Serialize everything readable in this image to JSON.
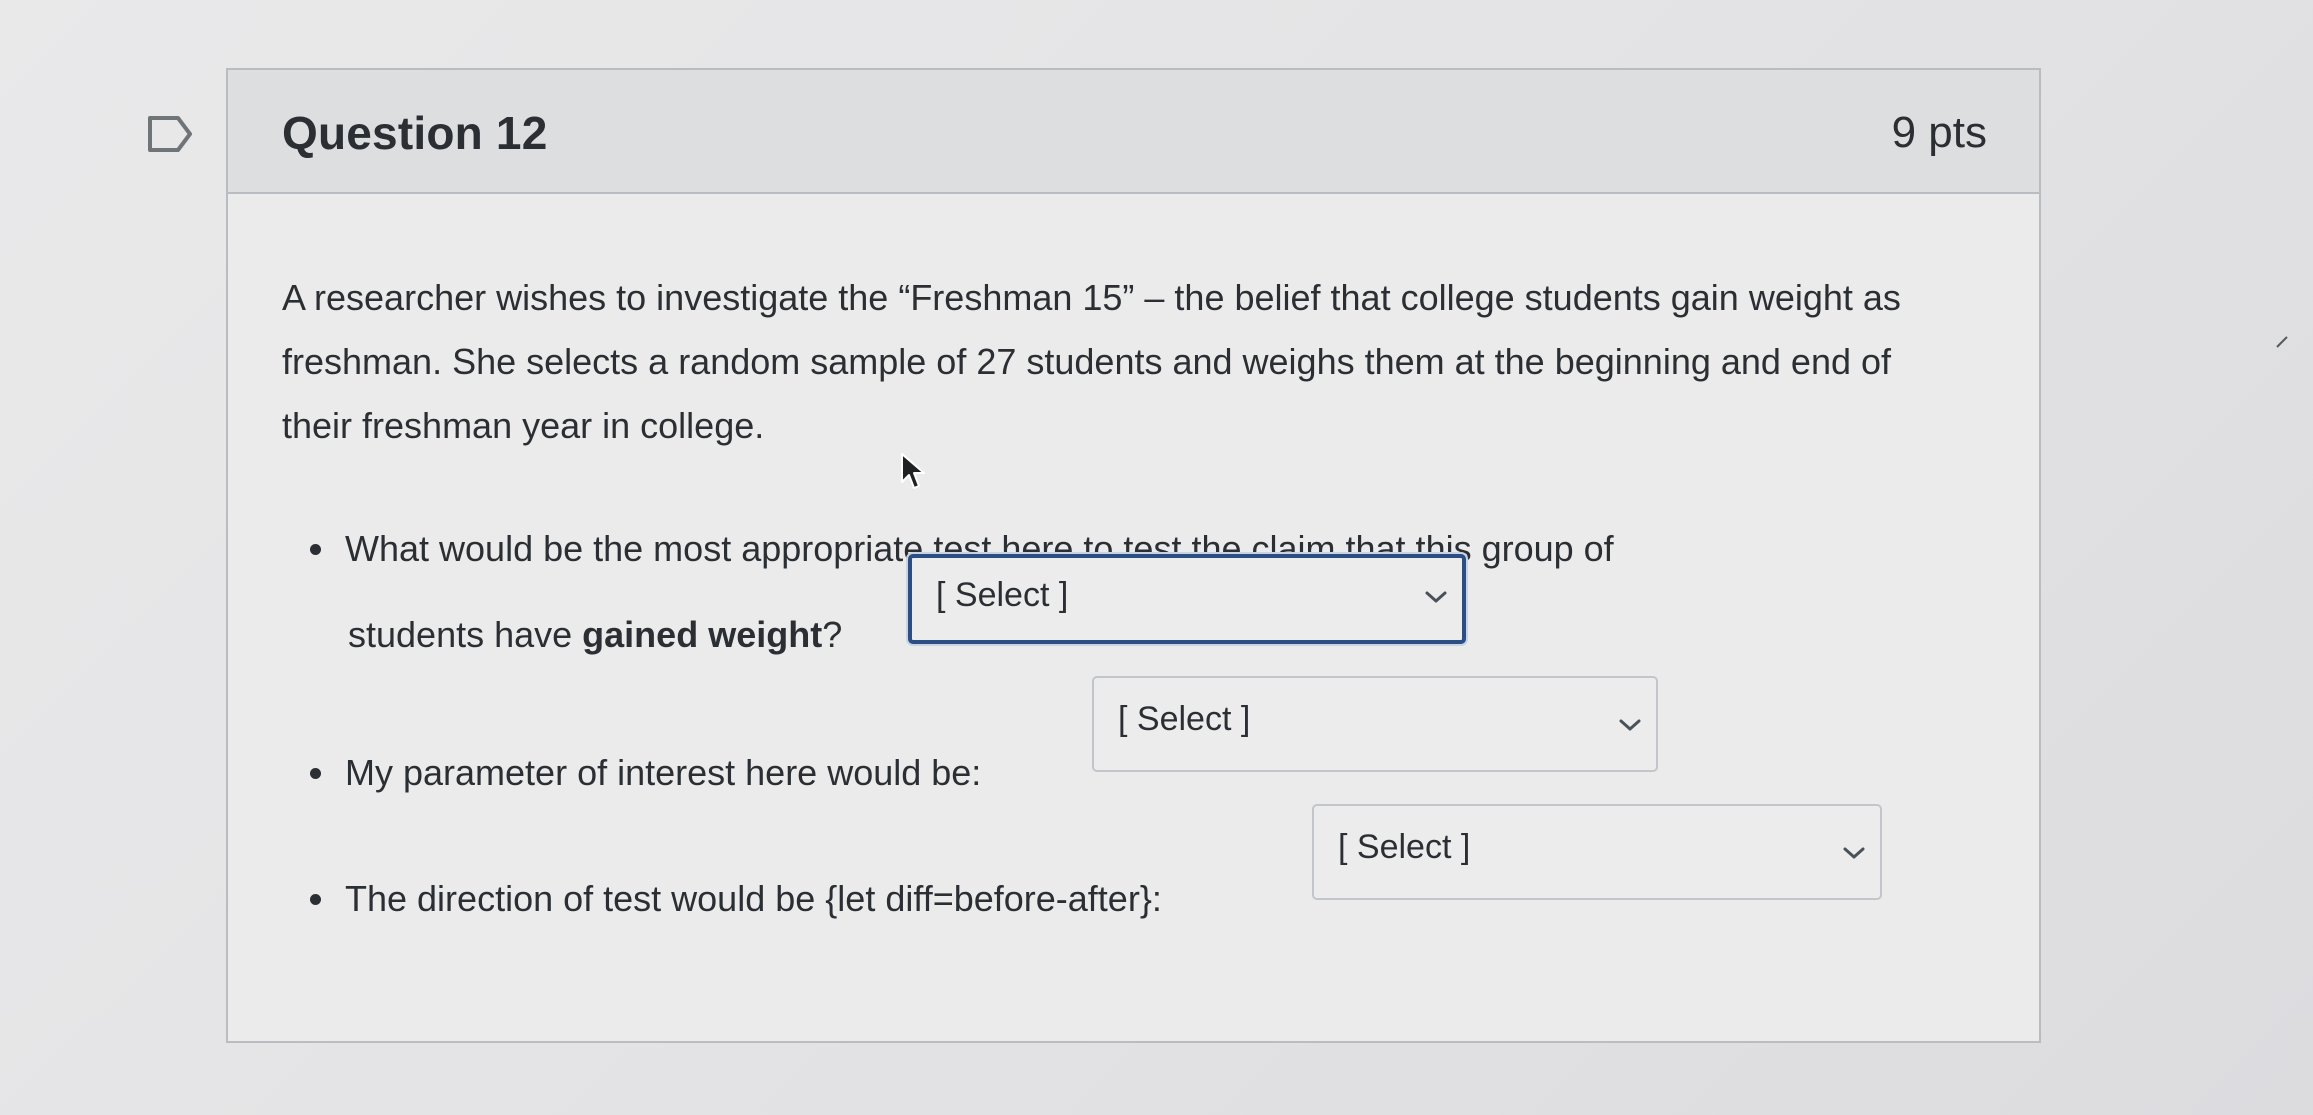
{
  "question": {
    "title": "Question 12",
    "points": "9 pts",
    "prompt": "A researcher wishes to investigate the “Freshman 15” – the belief that college students gain weight as freshman. She selects a random sample of 27 students and weighs them at the beginning and end of their freshman year in college.",
    "items": [
      {
        "text_line1": "What would be the most appropriate test here to test the claim that this group of",
        "text_line2_prefix": "students have ",
        "text_line2_bold": "gained weight",
        "text_line2_suffix": "?",
        "select_value": "[ Select ]"
      },
      {
        "text": "My parameter of interest here would be:",
        "select_value": "[ Select ]"
      },
      {
        "text": "The direction of test would be {let diff=before-after}:",
        "select_value": "[ Select ]"
      }
    ]
  },
  "icons": {
    "flag": "flag-outline-icon",
    "chevron": "chevron-down-icon",
    "pointer": "mouse-pointer-icon"
  },
  "colors": {
    "focus_border": "#2b4e83",
    "text": "#2b2f33",
    "card_border": "#b9bcc0"
  }
}
